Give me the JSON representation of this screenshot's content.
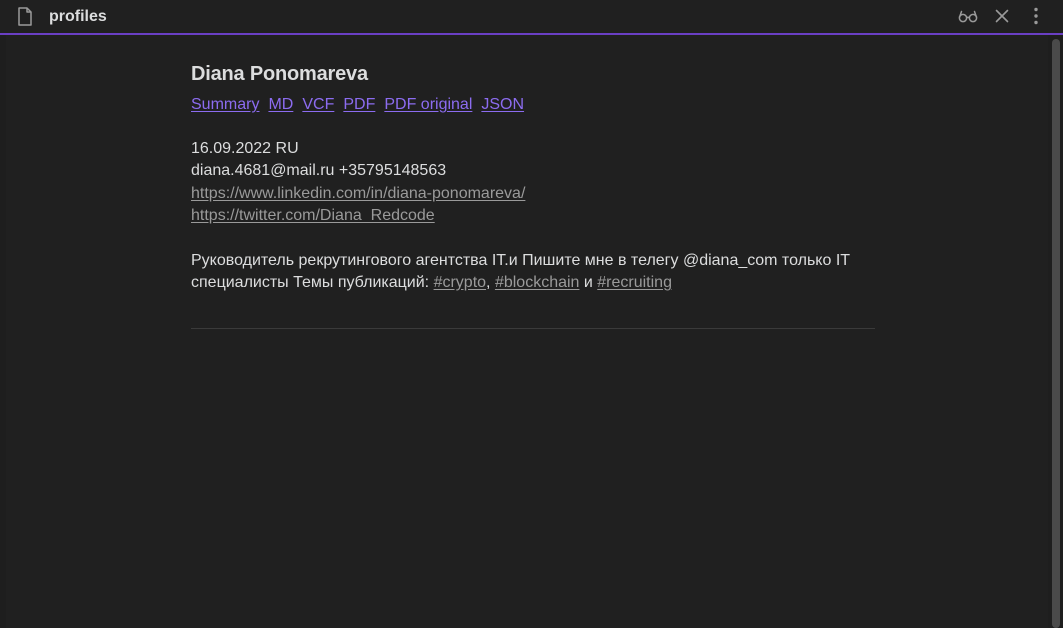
{
  "tab": {
    "title": "profiles",
    "icons": {
      "file": "file-icon",
      "reading_mode": "glasses-icon",
      "close": "close-icon",
      "more": "more-vertical-icon"
    }
  },
  "colors": {
    "accent": "#6a3fc4",
    "link": "#8c6cf0",
    "text": "#dcddde",
    "muted_link": "#9a9a9a",
    "background": "#202020"
  },
  "profile": {
    "name": "Diana Ponomareva",
    "nav": [
      {
        "label": "Summary"
      },
      {
        "label": "MD"
      },
      {
        "label": "VCF"
      },
      {
        "label": "PDF"
      },
      {
        "label": "PDF original"
      },
      {
        "label": "JSON"
      }
    ],
    "date_country": "16.09.2022 RU",
    "contact": "diana.4681@mail.ru +35795148563",
    "linkedin": "https://www.linkedin.com/in/diana-ponomareva/",
    "twitter": "https://twitter.com/Diana_Redcode",
    "bio": {
      "text": "Руководитель рекрутингового агентства IT.и Пишите мне в телегу @diana_com только IT специалисты Темы публикаций: ",
      "tags": [
        "#crypto",
        "#blockchain",
        "#recruiting"
      ],
      "sep_comma": ", ",
      "sep_and": " и "
    }
  }
}
